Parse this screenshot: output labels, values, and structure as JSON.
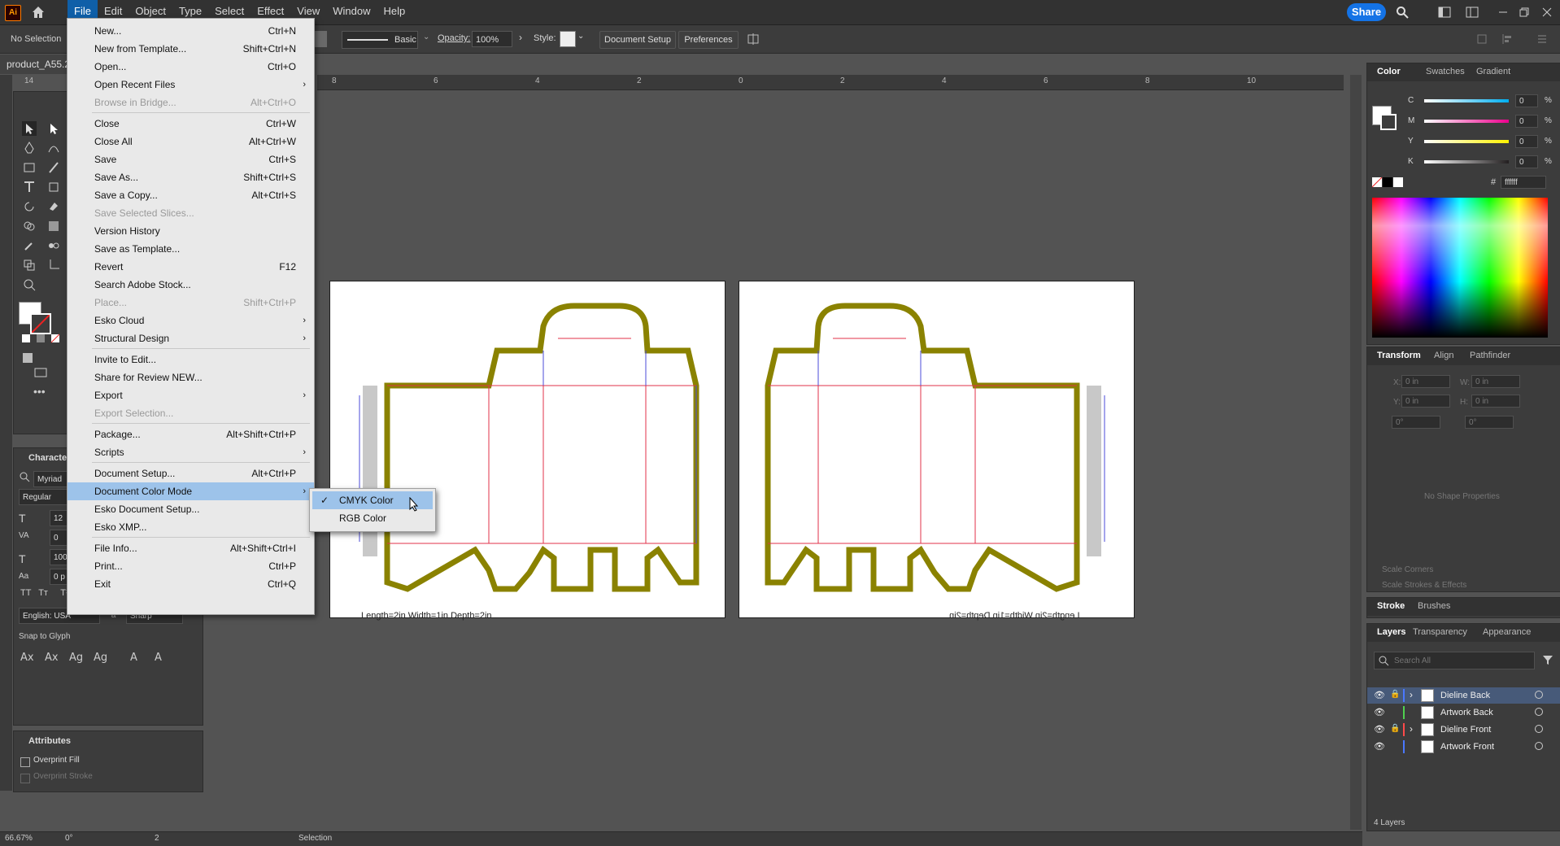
{
  "app": {
    "logo": "Ai",
    "share_label": "Share"
  },
  "menubar": {
    "items": [
      "File",
      "Edit",
      "Object",
      "Type",
      "Select",
      "Effect",
      "View",
      "Window",
      "Help"
    ]
  },
  "control_bar": {
    "no_selection": "No Selection",
    "stroke_style": "Basic",
    "opacity_label": "Opacity:",
    "opacity_value": "100%",
    "style_label": "Style:",
    "document_setup": "Document Setup",
    "preferences": "Preferences"
  },
  "document": {
    "tab_name": "product_A55.2",
    "ruler_ticks": [
      "8",
      "6",
      "4",
      "2",
      "0",
      "2",
      "4",
      "6",
      "8",
      "10"
    ],
    "left_ruler_top": "14"
  },
  "file_menu": [
    {
      "label": "New...",
      "shortcut": "Ctrl+N"
    },
    {
      "label": "New from Template...",
      "shortcut": "Shift+Ctrl+N"
    },
    {
      "label": "Open...",
      "shortcut": "Ctrl+O"
    },
    {
      "label": "Open Recent Files",
      "shortcut": "",
      "submenu": true
    },
    {
      "label": "Browse in Bridge...",
      "shortcut": "Alt+Ctrl+O",
      "disabled": true
    },
    {
      "label": "Close",
      "shortcut": "Ctrl+W"
    },
    {
      "label": "Close All",
      "shortcut": "Alt+Ctrl+W"
    },
    {
      "label": "Save",
      "shortcut": "Ctrl+S"
    },
    {
      "label": "Save As...",
      "shortcut": "Shift+Ctrl+S"
    },
    {
      "label": "Save a Copy...",
      "shortcut": "Alt+Ctrl+S"
    },
    {
      "label": "Save Selected Slices...",
      "shortcut": "",
      "disabled": true
    },
    {
      "label": "Version History",
      "shortcut": ""
    },
    {
      "label": "Save as Template...",
      "shortcut": ""
    },
    {
      "label": "Revert",
      "shortcut": "F12"
    },
    {
      "label": "Search Adobe Stock...",
      "shortcut": ""
    },
    {
      "label": "Place...",
      "shortcut": "Shift+Ctrl+P",
      "disabled": true
    },
    {
      "label": "Esko Cloud",
      "shortcut": "",
      "submenu": true
    },
    {
      "label": "Structural Design",
      "shortcut": "",
      "submenu": true
    },
    {
      "label": "Invite to Edit...",
      "shortcut": ""
    },
    {
      "label": "Share for Review NEW...",
      "shortcut": ""
    },
    {
      "label": "Export",
      "shortcut": "",
      "submenu": true
    },
    {
      "label": "Export Selection...",
      "shortcut": "",
      "disabled": true
    },
    {
      "label": "Package...",
      "shortcut": "Alt+Shift+Ctrl+P"
    },
    {
      "label": "Scripts",
      "shortcut": "",
      "submenu": true
    },
    {
      "label": "Document Setup...",
      "shortcut": "Alt+Ctrl+P"
    },
    {
      "label": "Document Color Mode",
      "shortcut": "",
      "submenu": true,
      "highlighted": true
    },
    {
      "label": "Esko Document Setup...",
      "shortcut": ""
    },
    {
      "label": "Esko XMP...",
      "shortcut": ""
    },
    {
      "label": "File Info...",
      "shortcut": "Alt+Shift+Ctrl+I"
    },
    {
      "label": "Print...",
      "shortcut": "Ctrl+P"
    },
    {
      "label": "Exit",
      "shortcut": "Ctrl+Q"
    }
  ],
  "color_mode_submenu": [
    {
      "label": "CMYK Color",
      "checked": true
    },
    {
      "label": "RGB Color",
      "checked": false
    }
  ],
  "character_panel": {
    "title": "Character",
    "font_family": "Myriad",
    "font_style": "Regular",
    "size": "12",
    "tracking": "0",
    "leading": "100",
    "baseline": "0 p",
    "language": "English: USA",
    "antialias": "Sharp",
    "snap_label": "Snap to Glyph"
  },
  "attributes_panel": {
    "title": "Attributes",
    "overprint_fill": "Overprint Fill",
    "overprint_stroke": "Overprint Stroke"
  },
  "artboards": {
    "left_caption": "Length=2in Width=1in Depth=2in",
    "right_caption": "Length=2in Width=1in Depth=2in"
  },
  "color_panel": {
    "tabs": [
      "Color",
      "Swatches",
      "Gradient"
    ],
    "channels": [
      {
        "name": "C",
        "value": "0",
        "color": "#00aeef"
      },
      {
        "name": "M",
        "value": "0",
        "color": "#ec008c"
      },
      {
        "name": "Y",
        "value": "0",
        "color": "#fff200"
      },
      {
        "name": "K",
        "value": "0",
        "color": "#231f20"
      }
    ],
    "percent": "%",
    "hex": "ffffff"
  },
  "transform_panel": {
    "tabs": [
      "Transform",
      "Align",
      "Pathfinder"
    ],
    "x": "0 in",
    "y": "0 in",
    "w": "0 in",
    "h": "0 in",
    "rotate": "0°",
    "shear": "0°",
    "no_shape": "No Shape Properties",
    "scale_corners": "Scale Corners",
    "scale_strokes": "Scale Strokes & Effects"
  },
  "stroke_panel": {
    "tabs": [
      "Stroke",
      "Brushes"
    ]
  },
  "layers_panel": {
    "tabs": [
      "Layers",
      "Transparency",
      "Appearance"
    ],
    "search_placeholder": "Search All",
    "layers": [
      {
        "name": "Dieline Back",
        "color": "#4a78ff",
        "locked": true,
        "expandable": true,
        "selected": true
      },
      {
        "name": "Artwork Back",
        "color": "#4fd14f",
        "locked": false,
        "expandable": false,
        "selected": false
      },
      {
        "name": "Dieline Front",
        "color": "#ff4a4a",
        "locked": true,
        "expandable": true,
        "selected": false
      },
      {
        "name": "Artwork Front",
        "color": "#4a78ff",
        "locked": false,
        "expandable": false,
        "selected": false
      }
    ],
    "footer_count": "4 Layers"
  },
  "status_bar": {
    "zoom": "66.67%",
    "rotation": "0°",
    "artboard": "2",
    "tool": "Selection"
  }
}
